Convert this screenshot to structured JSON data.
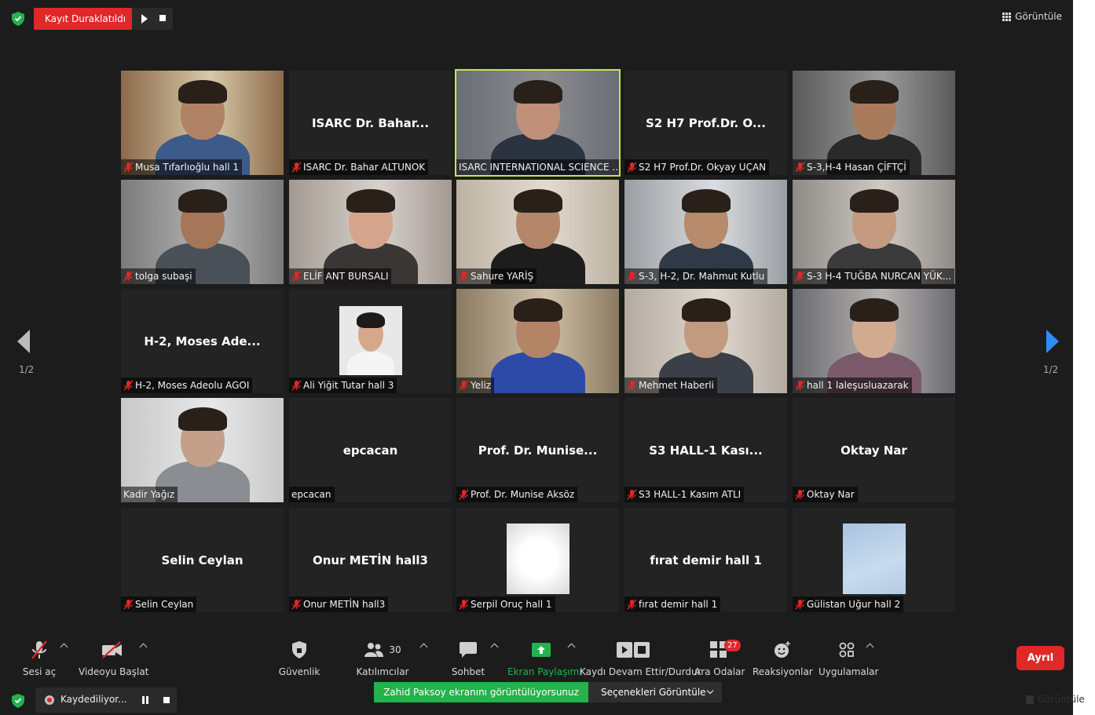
{
  "top_bar": {
    "recording_status": "Kayıt Duraklatıldı",
    "view_label": "Görüntüle"
  },
  "pager": {
    "left": "1/2",
    "right": "1/2"
  },
  "tiles": [
    {
      "display": "video",
      "name": "Musa Tıfarlıoğlu hall 1",
      "muted": true
    },
    {
      "display": "text",
      "title": "ISARC Dr. Bahar...",
      "name": "ISARC Dr. Bahar ALTUNOK",
      "muted": true
    },
    {
      "display": "video",
      "name": "ISARC INTERNATIONAL SCIENCE ...",
      "muted": false,
      "active_speaker": true
    },
    {
      "display": "text",
      "title": "S2 H7 Prof.Dr. O...",
      "name": "S2 H7 Prof.Dr. Okyay UÇAN",
      "muted": true
    },
    {
      "display": "video",
      "name": "S-3,H-4 Hasan ÇİFTÇİ",
      "muted": true
    },
    {
      "display": "video",
      "name": "tolga subaşi",
      "muted": true
    },
    {
      "display": "video",
      "name": "ELİF ANT BURSALI",
      "muted": true
    },
    {
      "display": "video",
      "name": "Sahure YARİŞ",
      "muted": true
    },
    {
      "display": "video",
      "name": "S-3, H-2, Dr. Mahmut Kutlu",
      "muted": true
    },
    {
      "display": "video",
      "name": "S-3 H-4 TUĞBA NURCAN YÜK...",
      "muted": true
    },
    {
      "display": "text",
      "title": "H-2, Moses Ade...",
      "name": "H-2, Moses Adeolu AGOI",
      "muted": true
    },
    {
      "display": "photo",
      "name": "Ali Yiğit Tutar hall 3",
      "muted": true
    },
    {
      "display": "video",
      "name": "Yeliz",
      "muted": true
    },
    {
      "display": "video",
      "name": "Mehmet Haberli",
      "muted": true
    },
    {
      "display": "video",
      "name": "hall 1 laleşusluazarak",
      "muted": true
    },
    {
      "display": "video",
      "name": "Kadir Yağız",
      "muted": false
    },
    {
      "display": "text",
      "title": "epcacan",
      "name": "epcacan",
      "muted": false
    },
    {
      "display": "text",
      "title": "Prof. Dr. Munise...",
      "name": "Prof. Dr. Munise Aksöz",
      "muted": true
    },
    {
      "display": "text",
      "title": "S3 HALL-1 Kası...",
      "name": "S3 HALL-1 Kasım ATLI",
      "muted": true
    },
    {
      "display": "text",
      "title": "Oktay Nar",
      "name": "Oktay Nar",
      "muted": true
    },
    {
      "display": "text",
      "title": "Selin Ceylan",
      "name": "Selin Ceylan",
      "muted": true
    },
    {
      "display": "text",
      "title": "Onur METİN hall3",
      "name": "Onur METİN hall3",
      "muted": true
    },
    {
      "display": "photo_blur",
      "name": "Serpil Oruç hall 1",
      "muted": true
    },
    {
      "display": "text",
      "title": "fırat demir hall 1",
      "name": "fırat demir hall 1",
      "muted": true
    },
    {
      "display": "photo_sky",
      "name": "Gülistan Uğur hall 2",
      "muted": true
    }
  ],
  "toolbar": {
    "unmute": "Sesi aç",
    "start_video": "Videoyu Başlat",
    "security": "Güvenlik",
    "participants": "Katılımcılar",
    "participants_count": "30",
    "chat": "Sohbet",
    "share_screen": "Ekran Paylaşımı",
    "record": "Kaydı Devam Ettir/Durdur",
    "breakout": "Ara Odalar",
    "breakout_badge": "27",
    "reactions": "Reaksiyonlar",
    "apps": "Uygulamalar",
    "leave": "Ayrıl"
  },
  "share_banner": {
    "text": "Zahid Paksoy ekranını görüntülüyorsunuz",
    "options": "Seçenekleri Görüntüle"
  },
  "bottom_bar": {
    "recording": "Kaydediliyor...",
    "view_label": "Görüntüle"
  },
  "colors": {
    "accent_blue": "#2d8cff",
    "record_red": "#e02828",
    "active_speaker": "#c6e64a",
    "share_green": "#23b24b"
  }
}
